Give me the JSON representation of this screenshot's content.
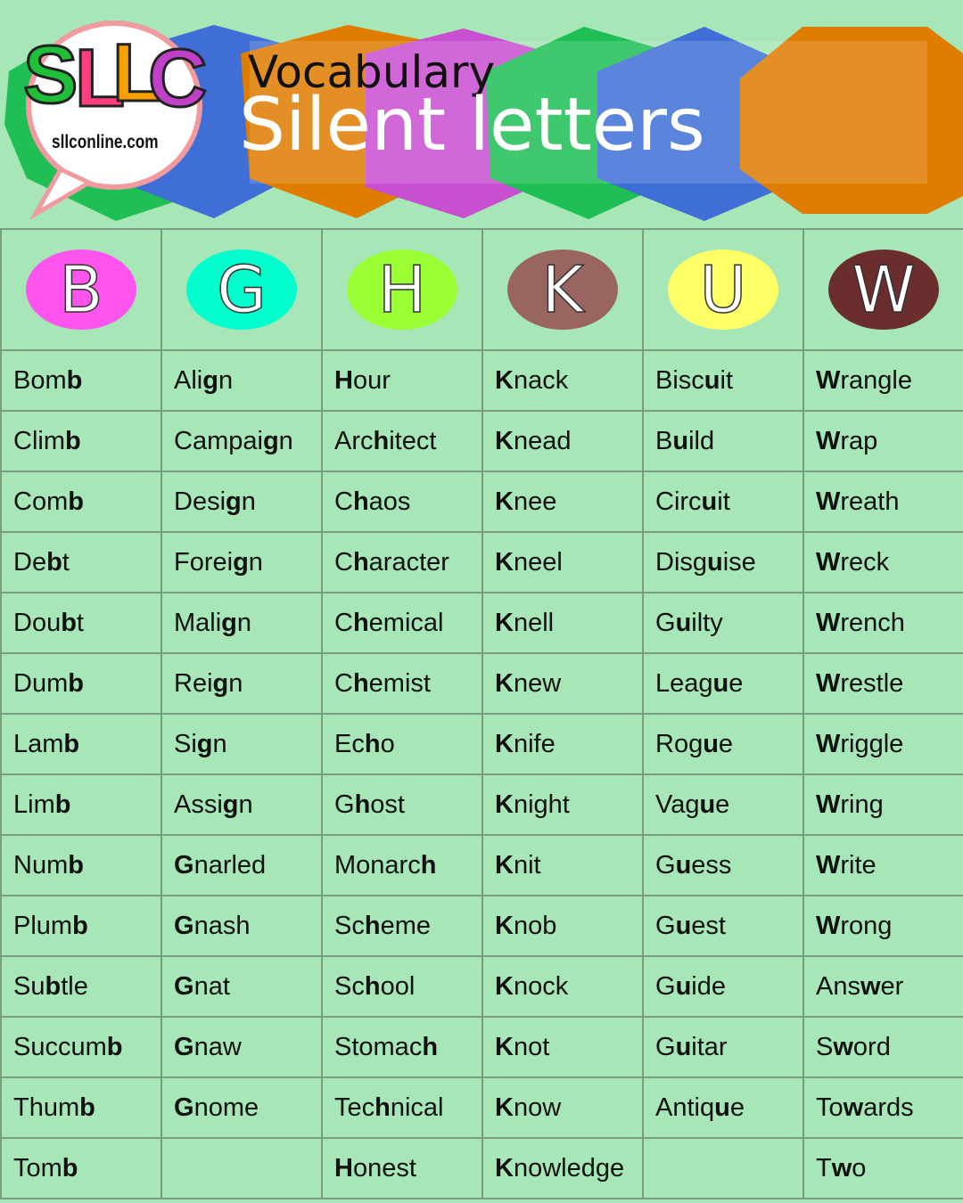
{
  "header": {
    "title_small": "Vocabulary",
    "title_big": "Silent letters",
    "logo": {
      "letters": [
        "S",
        "L",
        "L",
        "C"
      ],
      "url": "sllconline.com"
    }
  },
  "columns": [
    {
      "letter": "B",
      "color": "#ff55ee",
      "words": [
        {
          "pre": "Bom",
          "silent": "b",
          "post": ""
        },
        {
          "pre": "Clim",
          "silent": "b",
          "post": ""
        },
        {
          "pre": "Com",
          "silent": "b",
          "post": ""
        },
        {
          "pre": "De",
          "silent": "b",
          "post": "t"
        },
        {
          "pre": "Dou",
          "silent": "b",
          "post": "t"
        },
        {
          "pre": "Dum",
          "silent": "b",
          "post": ""
        },
        {
          "pre": "Lam",
          "silent": "b",
          "post": ""
        },
        {
          "pre": "Lim",
          "silent": "b",
          "post": ""
        },
        {
          "pre": "Num",
          "silent": "b",
          "post": ""
        },
        {
          "pre": "Plum",
          "silent": "b",
          "post": ""
        },
        {
          "pre": "Su",
          "silent": "b",
          "post": "tle"
        },
        {
          "pre": "Succum",
          "silent": "b",
          "post": ""
        },
        {
          "pre": "Thum",
          "silent": "b",
          "post": ""
        },
        {
          "pre": "Tom",
          "silent": "b",
          "post": ""
        }
      ]
    },
    {
      "letter": "G",
      "color": "#00ffcc",
      "words": [
        {
          "pre": "Ali",
          "silent": "g",
          "post": "n"
        },
        {
          "pre": "Campai",
          "silent": "g",
          "post": "n"
        },
        {
          "pre": "Desi",
          "silent": "g",
          "post": "n"
        },
        {
          "pre": "Forei",
          "silent": "g",
          "post": "n"
        },
        {
          "pre": "Mali",
          "silent": "g",
          "post": "n"
        },
        {
          "pre": "Rei",
          "silent": "g",
          "post": "n"
        },
        {
          "pre": "Si",
          "silent": "g",
          "post": "n"
        },
        {
          "pre": "Assi",
          "silent": "g",
          "post": "n"
        },
        {
          "pre": "",
          "silent": "G",
          "post": "narled"
        },
        {
          "pre": "",
          "silent": "G",
          "post": "nash"
        },
        {
          "pre": "",
          "silent": "G",
          "post": "nat"
        },
        {
          "pre": "",
          "silent": "G",
          "post": "naw"
        },
        {
          "pre": "",
          "silent": "G",
          "post": "nome"
        },
        {
          "pre": "",
          "silent": "",
          "post": ""
        }
      ]
    },
    {
      "letter": "H",
      "color": "#99ff33",
      "words": [
        {
          "pre": "",
          "silent": "H",
          "post": "our"
        },
        {
          "pre": "Arc",
          "silent": "h",
          "post": "itect"
        },
        {
          "pre": "C",
          "silent": "h",
          "post": "aos"
        },
        {
          "pre": "C",
          "silent": "h",
          "post": "aracter"
        },
        {
          "pre": "C",
          "silent": "h",
          "post": "emical"
        },
        {
          "pre": "C",
          "silent": "h",
          "post": "emist"
        },
        {
          "pre": "Ec",
          "silent": "h",
          "post": "o"
        },
        {
          "pre": "G",
          "silent": "h",
          "post": "ost"
        },
        {
          "pre": "Monarc",
          "silent": "h",
          "post": ""
        },
        {
          "pre": "Sc",
          "silent": "h",
          "post": "eme"
        },
        {
          "pre": "Sc",
          "silent": "h",
          "post": "ool"
        },
        {
          "pre": "Stomac",
          "silent": "h",
          "post": ""
        },
        {
          "pre": "Tec",
          "silent": "h",
          "post": "nical"
        },
        {
          "pre": "",
          "silent": "H",
          "post": "onest"
        }
      ]
    },
    {
      "letter": "K",
      "color": "#9a6560",
      "words": [
        {
          "pre": "",
          "silent": "K",
          "post": "nack"
        },
        {
          "pre": "",
          "silent": "K",
          "post": "nead"
        },
        {
          "pre": "",
          "silent": "K",
          "post": "nee"
        },
        {
          "pre": "",
          "silent": "K",
          "post": "neel"
        },
        {
          "pre": "",
          "silent": "K",
          "post": "nell"
        },
        {
          "pre": "",
          "silent": "K",
          "post": "new"
        },
        {
          "pre": "",
          "silent": "K",
          "post": "nife"
        },
        {
          "pre": "",
          "silent": "K",
          "post": "night"
        },
        {
          "pre": "",
          "silent": "K",
          "post": "nit"
        },
        {
          "pre": "",
          "silent": "K",
          "post": "nob"
        },
        {
          "pre": "",
          "silent": "K",
          "post": "nock"
        },
        {
          "pre": "",
          "silent": "K",
          "post": "not"
        },
        {
          "pre": "",
          "silent": "K",
          "post": "now"
        },
        {
          "pre": "",
          "silent": "K",
          "post": "nowledge"
        }
      ]
    },
    {
      "letter": "U",
      "color": "#ffff66",
      "words": [
        {
          "pre": "Bisc",
          "silent": "u",
          "post": "it"
        },
        {
          "pre": "B",
          "silent": "u",
          "post": "ild"
        },
        {
          "pre": "Circ",
          "silent": "u",
          "post": "it"
        },
        {
          "pre": "Disg",
          "silent": "u",
          "post": "ise"
        },
        {
          "pre": "G",
          "silent": "u",
          "post": "ilty"
        },
        {
          "pre": "Leag",
          "silent": "u",
          "post": "e"
        },
        {
          "pre": "Rog",
          "silent": "u",
          "post": "e"
        },
        {
          "pre": "Vag",
          "silent": "u",
          "post": "e"
        },
        {
          "pre": "G",
          "silent": "u",
          "post": "ess"
        },
        {
          "pre": "G",
          "silent": "u",
          "post": "est"
        },
        {
          "pre": "G",
          "silent": "u",
          "post": "ide"
        },
        {
          "pre": "G",
          "silent": "u",
          "post": "itar"
        },
        {
          "pre": "Antiq",
          "silent": "u",
          "post": "e"
        },
        {
          "pre": "",
          "silent": "",
          "post": ""
        }
      ]
    },
    {
      "letter": "W",
      "color": "#6b2e2e",
      "words": [
        {
          "pre": "",
          "silent": "W",
          "post": "rangle"
        },
        {
          "pre": "",
          "silent": "W",
          "post": "rap"
        },
        {
          "pre": "",
          "silent": "W",
          "post": "reath"
        },
        {
          "pre": "",
          "silent": "W",
          "post": "reck"
        },
        {
          "pre": "",
          "silent": "W",
          "post": "rench"
        },
        {
          "pre": "",
          "silent": "W",
          "post": "restle"
        },
        {
          "pre": "",
          "silent": "W",
          "post": "riggle"
        },
        {
          "pre": "",
          "silent": "W",
          "post": "ring"
        },
        {
          "pre": "",
          "silent": "W",
          "post": "rite"
        },
        {
          "pre": "",
          "silent": "W",
          "post": "rong"
        },
        {
          "pre": "Ans",
          "silent": "w",
          "post": "er"
        },
        {
          "pre": "S",
          "silent": "w",
          "post": "ord"
        },
        {
          "pre": "To",
          "silent": "w",
          "post": "ards"
        },
        {
          "pre": "T",
          "silent": "w",
          "post": "o"
        }
      ]
    }
  ]
}
